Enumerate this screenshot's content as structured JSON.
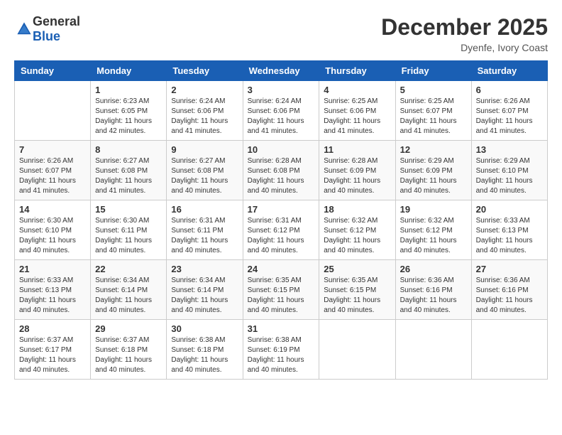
{
  "header": {
    "logo": {
      "general": "General",
      "blue": "Blue"
    },
    "title": "December 2025",
    "location": "Dyenfe, Ivory Coast"
  },
  "calendar": {
    "days_of_week": [
      "Sunday",
      "Monday",
      "Tuesday",
      "Wednesday",
      "Thursday",
      "Friday",
      "Saturday"
    ],
    "weeks": [
      [
        {
          "day": "",
          "sunrise": "",
          "sunset": "",
          "daylight": ""
        },
        {
          "day": "1",
          "sunrise": "Sunrise: 6:23 AM",
          "sunset": "Sunset: 6:05 PM",
          "daylight": "Daylight: 11 hours and 42 minutes."
        },
        {
          "day": "2",
          "sunrise": "Sunrise: 6:24 AM",
          "sunset": "Sunset: 6:06 PM",
          "daylight": "Daylight: 11 hours and 41 minutes."
        },
        {
          "day": "3",
          "sunrise": "Sunrise: 6:24 AM",
          "sunset": "Sunset: 6:06 PM",
          "daylight": "Daylight: 11 hours and 41 minutes."
        },
        {
          "day": "4",
          "sunrise": "Sunrise: 6:25 AM",
          "sunset": "Sunset: 6:06 PM",
          "daylight": "Daylight: 11 hours and 41 minutes."
        },
        {
          "day": "5",
          "sunrise": "Sunrise: 6:25 AM",
          "sunset": "Sunset: 6:07 PM",
          "daylight": "Daylight: 11 hours and 41 minutes."
        },
        {
          "day": "6",
          "sunrise": "Sunrise: 6:26 AM",
          "sunset": "Sunset: 6:07 PM",
          "daylight": "Daylight: 11 hours and 41 minutes."
        }
      ],
      [
        {
          "day": "7",
          "sunrise": "Sunrise: 6:26 AM",
          "sunset": "Sunset: 6:07 PM",
          "daylight": "Daylight: 11 hours and 41 minutes."
        },
        {
          "day": "8",
          "sunrise": "Sunrise: 6:27 AM",
          "sunset": "Sunset: 6:08 PM",
          "daylight": "Daylight: 11 hours and 41 minutes."
        },
        {
          "day": "9",
          "sunrise": "Sunrise: 6:27 AM",
          "sunset": "Sunset: 6:08 PM",
          "daylight": "Daylight: 11 hours and 40 minutes."
        },
        {
          "day": "10",
          "sunrise": "Sunrise: 6:28 AM",
          "sunset": "Sunset: 6:08 PM",
          "daylight": "Daylight: 11 hours and 40 minutes."
        },
        {
          "day": "11",
          "sunrise": "Sunrise: 6:28 AM",
          "sunset": "Sunset: 6:09 PM",
          "daylight": "Daylight: 11 hours and 40 minutes."
        },
        {
          "day": "12",
          "sunrise": "Sunrise: 6:29 AM",
          "sunset": "Sunset: 6:09 PM",
          "daylight": "Daylight: 11 hours and 40 minutes."
        },
        {
          "day": "13",
          "sunrise": "Sunrise: 6:29 AM",
          "sunset": "Sunset: 6:10 PM",
          "daylight": "Daylight: 11 hours and 40 minutes."
        }
      ],
      [
        {
          "day": "14",
          "sunrise": "Sunrise: 6:30 AM",
          "sunset": "Sunset: 6:10 PM",
          "daylight": "Daylight: 11 hours and 40 minutes."
        },
        {
          "day": "15",
          "sunrise": "Sunrise: 6:30 AM",
          "sunset": "Sunset: 6:11 PM",
          "daylight": "Daylight: 11 hours and 40 minutes."
        },
        {
          "day": "16",
          "sunrise": "Sunrise: 6:31 AM",
          "sunset": "Sunset: 6:11 PM",
          "daylight": "Daylight: 11 hours and 40 minutes."
        },
        {
          "day": "17",
          "sunrise": "Sunrise: 6:31 AM",
          "sunset": "Sunset: 6:12 PM",
          "daylight": "Daylight: 11 hours and 40 minutes."
        },
        {
          "day": "18",
          "sunrise": "Sunrise: 6:32 AM",
          "sunset": "Sunset: 6:12 PM",
          "daylight": "Daylight: 11 hours and 40 minutes."
        },
        {
          "day": "19",
          "sunrise": "Sunrise: 6:32 AM",
          "sunset": "Sunset: 6:12 PM",
          "daylight": "Daylight: 11 hours and 40 minutes."
        },
        {
          "day": "20",
          "sunrise": "Sunrise: 6:33 AM",
          "sunset": "Sunset: 6:13 PM",
          "daylight": "Daylight: 11 hours and 40 minutes."
        }
      ],
      [
        {
          "day": "21",
          "sunrise": "Sunrise: 6:33 AM",
          "sunset": "Sunset: 6:13 PM",
          "daylight": "Daylight: 11 hours and 40 minutes."
        },
        {
          "day": "22",
          "sunrise": "Sunrise: 6:34 AM",
          "sunset": "Sunset: 6:14 PM",
          "daylight": "Daylight: 11 hours and 40 minutes."
        },
        {
          "day": "23",
          "sunrise": "Sunrise: 6:34 AM",
          "sunset": "Sunset: 6:14 PM",
          "daylight": "Daylight: 11 hours and 40 minutes."
        },
        {
          "day": "24",
          "sunrise": "Sunrise: 6:35 AM",
          "sunset": "Sunset: 6:15 PM",
          "daylight": "Daylight: 11 hours and 40 minutes."
        },
        {
          "day": "25",
          "sunrise": "Sunrise: 6:35 AM",
          "sunset": "Sunset: 6:15 PM",
          "daylight": "Daylight: 11 hours and 40 minutes."
        },
        {
          "day": "26",
          "sunrise": "Sunrise: 6:36 AM",
          "sunset": "Sunset: 6:16 PM",
          "daylight": "Daylight: 11 hours and 40 minutes."
        },
        {
          "day": "27",
          "sunrise": "Sunrise: 6:36 AM",
          "sunset": "Sunset: 6:16 PM",
          "daylight": "Daylight: 11 hours and 40 minutes."
        }
      ],
      [
        {
          "day": "28",
          "sunrise": "Sunrise: 6:37 AM",
          "sunset": "Sunset: 6:17 PM",
          "daylight": "Daylight: 11 hours and 40 minutes."
        },
        {
          "day": "29",
          "sunrise": "Sunrise: 6:37 AM",
          "sunset": "Sunset: 6:18 PM",
          "daylight": "Daylight: 11 hours and 40 minutes."
        },
        {
          "day": "30",
          "sunrise": "Sunrise: 6:38 AM",
          "sunset": "Sunset: 6:18 PM",
          "daylight": "Daylight: 11 hours and 40 minutes."
        },
        {
          "day": "31",
          "sunrise": "Sunrise: 6:38 AM",
          "sunset": "Sunset: 6:19 PM",
          "daylight": "Daylight: 11 hours and 40 minutes."
        },
        {
          "day": "",
          "sunrise": "",
          "sunset": "",
          "daylight": ""
        },
        {
          "day": "",
          "sunrise": "",
          "sunset": "",
          "daylight": ""
        },
        {
          "day": "",
          "sunrise": "",
          "sunset": "",
          "daylight": ""
        }
      ]
    ]
  }
}
